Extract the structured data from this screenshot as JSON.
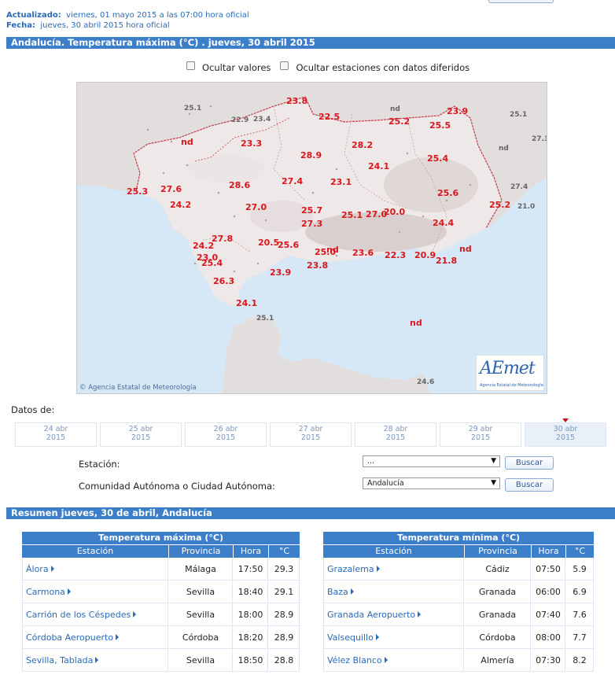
{
  "header": {
    "updated_label": "Actualizado:",
    "updated_value": "viernes, 01 mayo 2015 a las 07:00 hora oficial",
    "date_label": "Fecha:",
    "date_value": "jueves, 30 abril 2015 hora oficial"
  },
  "title_bar": "Andalucía. Temperatura máxima (°C) . jueves, 30 abril 2015",
  "options": {
    "hide_values": "Ocultar valores",
    "hide_deferred": "Ocultar estaciones con datos diferidos"
  },
  "map": {
    "copyright": "Agencia Estatal de Meteorología",
    "logo_text": "AEmet",
    "logo_sub": "Agencia Estatal de Meteorología",
    "values": [
      {
        "v": "23.8",
        "c": "red"
      },
      {
        "v": "22.5",
        "c": "red"
      },
      {
        "v": "nd",
        "c": "gray"
      },
      {
        "v": "23.9",
        "c": "red"
      },
      {
        "v": "25.2",
        "c": "red"
      },
      {
        "v": "25.5",
        "c": "red"
      },
      {
        "v": "25.1",
        "c": "gray"
      },
      {
        "v": "22.9",
        "c": "gray"
      },
      {
        "v": "23.4",
        "c": "gray"
      },
      {
        "v": "25.1",
        "c": "gray"
      },
      {
        "v": "nd",
        "c": "red"
      },
      {
        "v": "23.3",
        "c": "red"
      },
      {
        "v": "28.2",
        "c": "red"
      },
      {
        "v": "28.9",
        "c": "red"
      },
      {
        "v": "nd",
        "c": "gray"
      },
      {
        "v": "27.3",
        "c": "gray"
      },
      {
        "v": "25.4",
        "c": "red"
      },
      {
        "v": "24.1",
        "c": "red"
      },
      {
        "v": "25.3",
        "c": "red"
      },
      {
        "v": "27.6",
        "c": "red"
      },
      {
        "v": "28.6",
        "c": "red"
      },
      {
        "v": "27.4",
        "c": "red"
      },
      {
        "v": "23.1",
        "c": "red"
      },
      {
        "v": "27.4",
        "c": "gray"
      },
      {
        "v": "24.2",
        "c": "red"
      },
      {
        "v": "27.0",
        "c": "red"
      },
      {
        "v": "25.7",
        "c": "red"
      },
      {
        "v": "25.1",
        "c": "red"
      },
      {
        "v": "27.0",
        "c": "red"
      },
      {
        "v": "20.0",
        "c": "red"
      },
      {
        "v": "25.6",
        "c": "red"
      },
      {
        "v": "25.2",
        "c": "red"
      },
      {
        "v": "21.0",
        "c": "gray"
      },
      {
        "v": "27.3",
        "c": "red"
      },
      {
        "v": "24.4",
        "c": "red"
      },
      {
        "v": "27.8",
        "c": "red"
      },
      {
        "v": "20.5",
        "c": "red"
      },
      {
        "v": "25.6",
        "c": "red"
      },
      {
        "v": "24.2",
        "c": "red"
      },
      {
        "v": "nd",
        "c": "red"
      },
      {
        "v": "25.0",
        "c": "red"
      },
      {
        "v": "23.0",
        "c": "red"
      },
      {
        "v": "25.4",
        "c": "red"
      },
      {
        "v": "23.6",
        "c": "red"
      },
      {
        "v": "22.3",
        "c": "red"
      },
      {
        "v": "20.9",
        "c": "red"
      },
      {
        "v": "21.8",
        "c": "red"
      },
      {
        "v": "nd",
        "c": "red"
      },
      {
        "v": "23.8",
        "c": "red"
      },
      {
        "v": "23.9",
        "c": "red"
      },
      {
        "v": "26.3",
        "c": "red"
      },
      {
        "v": "24.1",
        "c": "red"
      },
      {
        "v": "25.1",
        "c": "gray"
      },
      {
        "v": "nd",
        "c": "red"
      },
      {
        "v": "24.6",
        "c": "gray"
      }
    ]
  },
  "datos_label": "Datos de:",
  "dates": [
    {
      "d": "24 abr",
      "y": "2015"
    },
    {
      "d": "25 abr",
      "y": "2015"
    },
    {
      "d": "26 abr",
      "y": "2015"
    },
    {
      "d": "27 abr",
      "y": "2015"
    },
    {
      "d": "28 abr",
      "y": "2015"
    },
    {
      "d": "29 abr",
      "y": "2015"
    },
    {
      "d": "30 abr",
      "y": "2015"
    }
  ],
  "form": {
    "station_label": "Estación:",
    "station_value": "...",
    "ccaa_label": "Comunidad Autónoma o Ciudad Autónoma:",
    "ccaa_value": "Andalucía",
    "search": "Buscar"
  },
  "summary_bar": "Resumen jueves, 30 de abril, Andalucía",
  "table_max": {
    "title": "Temperatura máxima (°C)",
    "headers": [
      "Estación",
      "Provincia",
      "Hora",
      "°C"
    ],
    "rows": [
      [
        "Álora",
        "Málaga",
        "17:50",
        "29.3"
      ],
      [
        "Carmona",
        "Sevilla",
        "18:40",
        "29.1"
      ],
      [
        "Carrión de los Céspedes",
        "Sevilla",
        "18:00",
        "28.9"
      ],
      [
        "Córdoba Aeropuerto",
        "Córdoba",
        "18:20",
        "28.9"
      ],
      [
        "Sevilla, Tablada",
        "Sevilla",
        "18:50",
        "28.8"
      ]
    ]
  },
  "table_min": {
    "title": "Temperatura mínima (°C)",
    "headers": [
      "Estación",
      "Provincia",
      "Hora",
      "°C"
    ],
    "rows": [
      [
        "Grazalema",
        "Cádiz",
        "07:50",
        "5.9"
      ],
      [
        "Baza",
        "Granada",
        "06:00",
        "6.9"
      ],
      [
        "Granada Aeropuerto",
        "Granada",
        "07:40",
        "7.6"
      ],
      [
        "Valsequillo",
        "Córdoba",
        "08:00",
        "7.7"
      ],
      [
        "Vélez Blanco",
        "Almería",
        "07:30",
        "8.2"
      ]
    ]
  },
  "colors": {
    "accent": "#3d7ec9",
    "link": "#2a6ab8",
    "value_red": "#d8171c",
    "sea": "#d6e7f5"
  }
}
